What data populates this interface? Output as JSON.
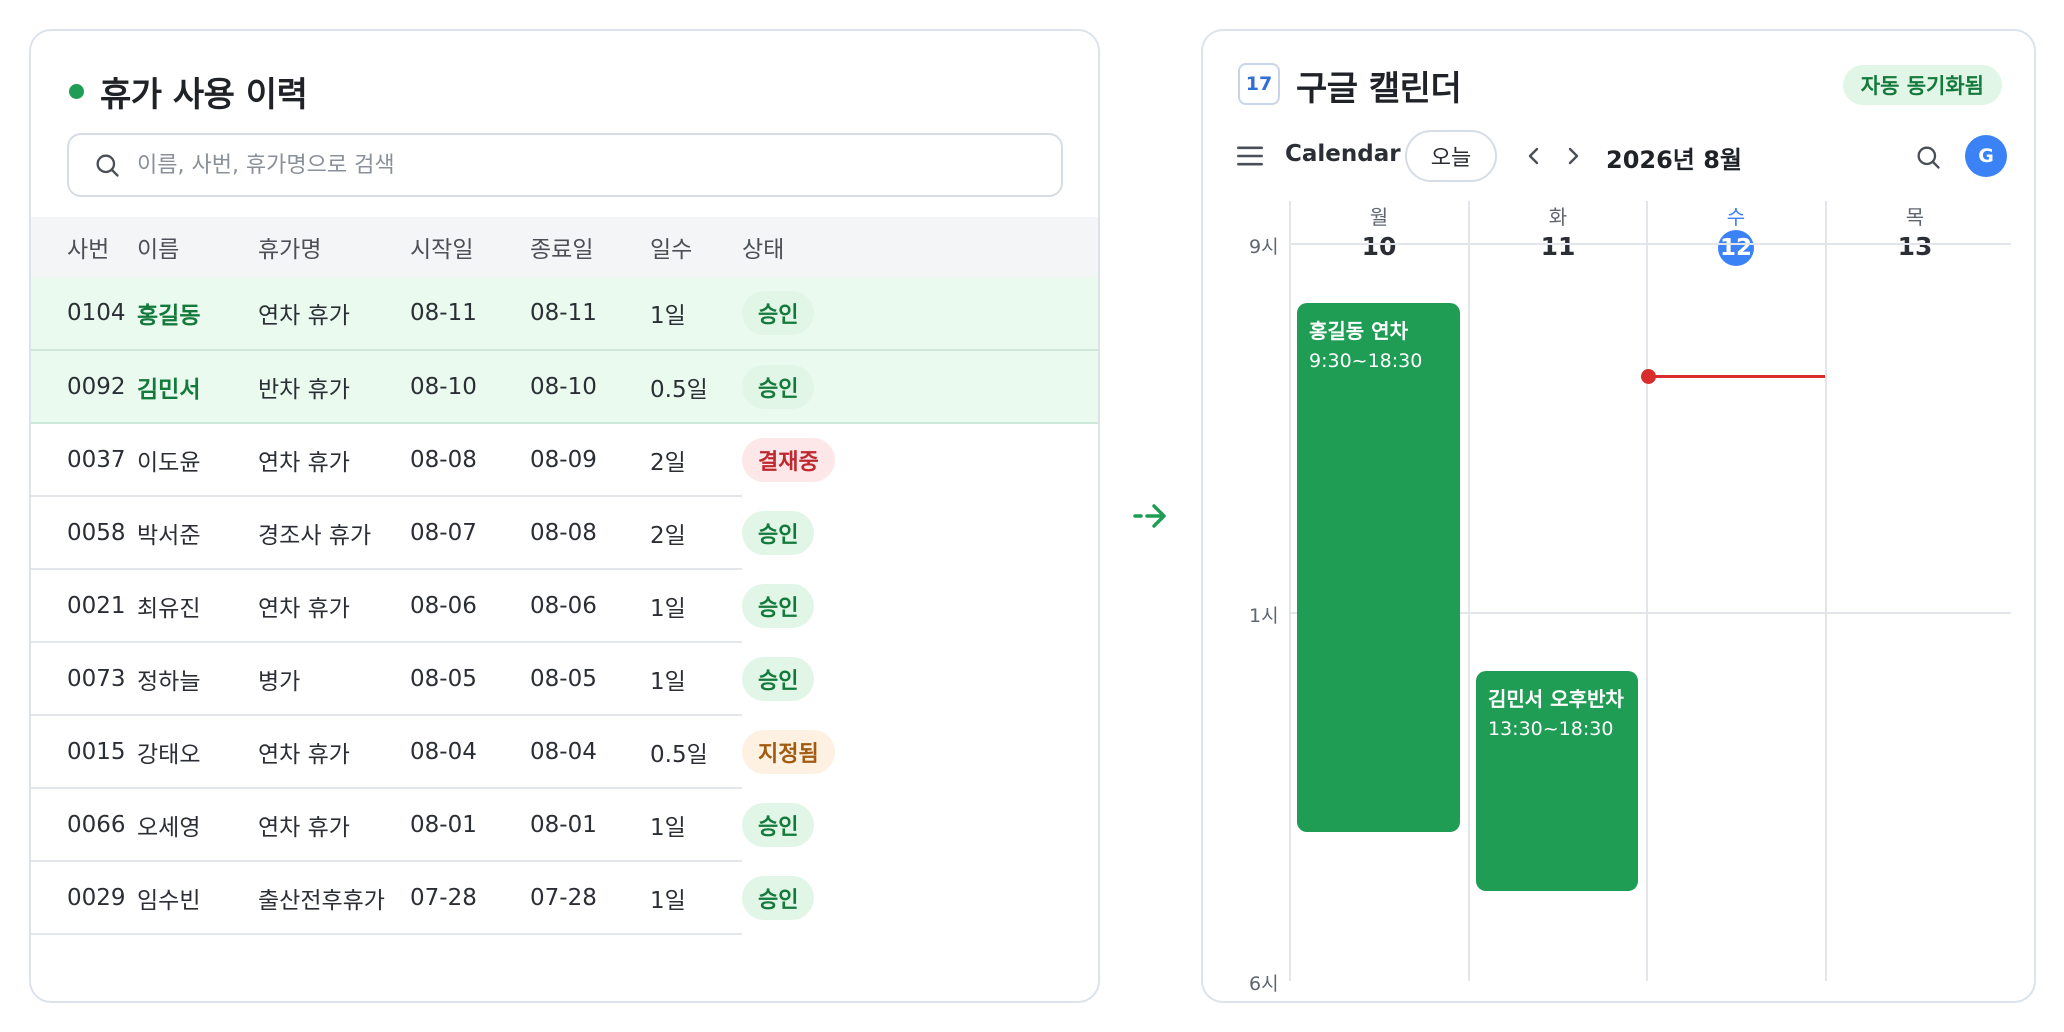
{
  "leave_history": {
    "title": "휴가 사용 이력",
    "search_placeholder": "이름, 사번, 휴가명으로 검색",
    "columns": [
      "사번",
      "이름",
      "휴가명",
      "시작일",
      "종료일",
      "일수",
      "상태"
    ],
    "rows": [
      {
        "id": "0104",
        "name": "홍길동",
        "type": "연차 휴가",
        "start": "08-11",
        "end": "08-11",
        "days": "1일",
        "status": "승인"
      },
      {
        "id": "0092",
        "name": "김민서",
        "type": "반차 휴가",
        "start": "08-10",
        "end": "08-10",
        "days": "0.5일",
        "status": "승인"
      },
      {
        "id": "0037",
        "name": "이도윤",
        "type": "연차 휴가",
        "start": "08-08",
        "end": "08-09",
        "days": "2일",
        "status": "결재중"
      },
      {
        "id": "0058",
        "name": "박서준",
        "type": "경조사 휴가",
        "start": "08-07",
        "end": "08-08",
        "days": "2일",
        "status": "승인"
      },
      {
        "id": "0021",
        "name": "최유진",
        "type": "연차 휴가",
        "start": "08-06",
        "end": "08-06",
        "days": "1일",
        "status": "승인"
      },
      {
        "id": "0073",
        "name": "정하늘",
        "type": "병가",
        "start": "08-05",
        "end": "08-05",
        "days": "1일",
        "status": "승인"
      },
      {
        "id": "0015",
        "name": "강태오",
        "type": "연차 휴가",
        "start": "08-04",
        "end": "08-04",
        "days": "0.5일",
        "status": "지정됨"
      },
      {
        "id": "0066",
        "name": "오세영",
        "type": "연차 휴가",
        "start": "08-01",
        "end": "08-01",
        "days": "1일",
        "status": "승인"
      },
      {
        "id": "0029",
        "name": "임수빈",
        "type": "출산전후휴가",
        "start": "07-28",
        "end": "07-28",
        "days": "1일",
        "status": "승인"
      }
    ]
  },
  "calendar": {
    "logo_text": "17",
    "title": "구글 캘린더",
    "sync_badge": "자동 동기화됨",
    "app_name": "Calendar",
    "today_button": "오늘",
    "month_label": "2026년 8월",
    "avatar_initial": "G",
    "days": [
      {
        "name": "월",
        "num": "10"
      },
      {
        "name": "화",
        "num": "11"
      },
      {
        "name": "수",
        "num": "12"
      },
      {
        "name": "목",
        "num": "13"
      }
    ],
    "time_labels": [
      "9시",
      "1시",
      "6시"
    ],
    "events": [
      {
        "title": "홍길동 연차",
        "time": "9:30~18:30"
      },
      {
        "title": "김민서 오후반차",
        "time": "13:30~18:30"
      }
    ]
  },
  "colors": {
    "accent_green": "#1f9d55",
    "today_blue": "#3b82f6",
    "now_red": "#d92d2d",
    "status_ok": "#137a3b",
    "status_pending": "#c0282f",
    "status_assigned": "#a25a10"
  }
}
